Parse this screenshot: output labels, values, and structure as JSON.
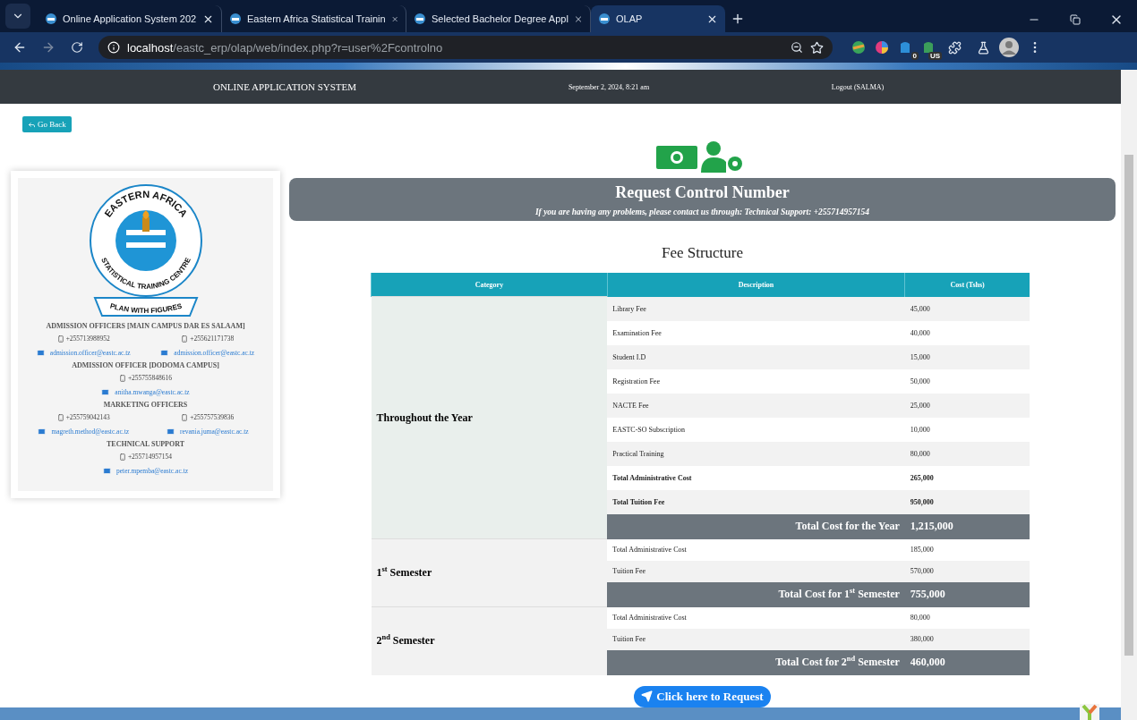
{
  "browser": {
    "tabs": [
      {
        "title": "Online Application System 202",
        "selected": false
      },
      {
        "title": "Eastern Africa Statistical Trainin",
        "selected": false
      },
      {
        "title": "Selected Bachelor Degree Appl",
        "selected": false
      },
      {
        "title": "OLAP",
        "selected": true
      }
    ],
    "address": {
      "host": "localhost",
      "path": "/eastc_erp/olap/web/index.php?r=user%2Fcontrolno"
    },
    "extension_badges": [
      "0",
      "US"
    ]
  },
  "nav": {
    "title": "ONLINE APPLICATION SYSTEM",
    "datetime": "September 2, 2024, 8:21 am",
    "logout": "Logout (SALMA)"
  },
  "back_button": "Go Back",
  "logo": {
    "top": "EASTERN AFRICA",
    "bottom": "STATISTICAL TRAINING CENTRE",
    "ribbon": "PLAN WITH FIGURES"
  },
  "contact_sections": [
    {
      "heading": "ADMISSION OFFICERS [MAIN CAMPUS DAR ES SALAAM]",
      "people": [
        {
          "phone": "+255713988952",
          "email": "admission.officer@eastc.ac.tz"
        },
        {
          "phone": "+255621171738",
          "email": "admission.officer@eastc.ac.tz"
        }
      ]
    },
    {
      "heading": "ADMISSION OFFICER [DODOMA CAMPUS]",
      "people": [
        {
          "phone": "+255755848616",
          "email": "anitha.mwanga@eastc.ac.tz"
        }
      ]
    },
    {
      "heading": "MARKETING OFFICERS",
      "people": [
        {
          "phone": "+255759042143",
          "email": "magreth.method@eastc.ac.tz"
        },
        {
          "phone": "+255757539836",
          "email": "revania.juma@eastc.ac.tz"
        }
      ]
    },
    {
      "heading": "TECHNICAL SUPPORT",
      "people": [
        {
          "phone": "+255714957154",
          "email": "peter.mpemba@eastc.ac.tz"
        }
      ]
    }
  ],
  "banner": {
    "title": "Request Control Number",
    "subtitle": "If you are having any problems, please contact us through: Technical Support: +255714957154"
  },
  "fee_table": {
    "title": "Fee Structure",
    "columns": [
      "Category",
      "Description",
      "Cost (Tshs)"
    ],
    "groups": [
      {
        "category": "Throughout the Year",
        "rows": [
          {
            "description": "Library Fee",
            "cost": "45,000",
            "kind": "item"
          },
          {
            "description": "Examination Fee",
            "cost": "40,000",
            "kind": "item"
          },
          {
            "description": "Student I.D",
            "cost": "15,000",
            "kind": "item"
          },
          {
            "description": "Registration Fee",
            "cost": "50,000",
            "kind": "item"
          },
          {
            "description": "NACTE Fee",
            "cost": "25,000",
            "kind": "item"
          },
          {
            "description": "EASTC-SO Subscription",
            "cost": "10,000",
            "kind": "item"
          },
          {
            "description": "Practical Training",
            "cost": "80,000",
            "kind": "item"
          },
          {
            "description": "Total Administrative Cost",
            "cost": "265,000",
            "kind": "subtotal"
          },
          {
            "description": "Total Tuition Fee",
            "cost": "950,000",
            "kind": "subtotal"
          }
        ],
        "total": {
          "label": "Total Cost for the Year",
          "cost": "1,215,000"
        }
      },
      {
        "category": "1$^{st}$ Semester",
        "rows": [
          {
            "description": "Total Administrative Cost",
            "cost": "185,000",
            "kind": "item"
          },
          {
            "description": "Tuition Fee",
            "cost": "570,000",
            "kind": "item"
          }
        ],
        "total": {
          "label": "Total Cost for 1$^{st}$ Semester",
          "cost": "755,000"
        }
      },
      {
        "category": "2$^{nd}$ Semester",
        "rows": [
          {
            "description": "Total Administrative Cost",
            "cost": "80,000",
            "kind": "item"
          },
          {
            "description": "Tuition Fee",
            "cost": "380,000",
            "kind": "item"
          }
        ],
        "total": {
          "label": "Total Cost for 2$^{nd}$ Semester",
          "cost": "460,000"
        }
      }
    ]
  },
  "request_button": "Click here to Request"
}
